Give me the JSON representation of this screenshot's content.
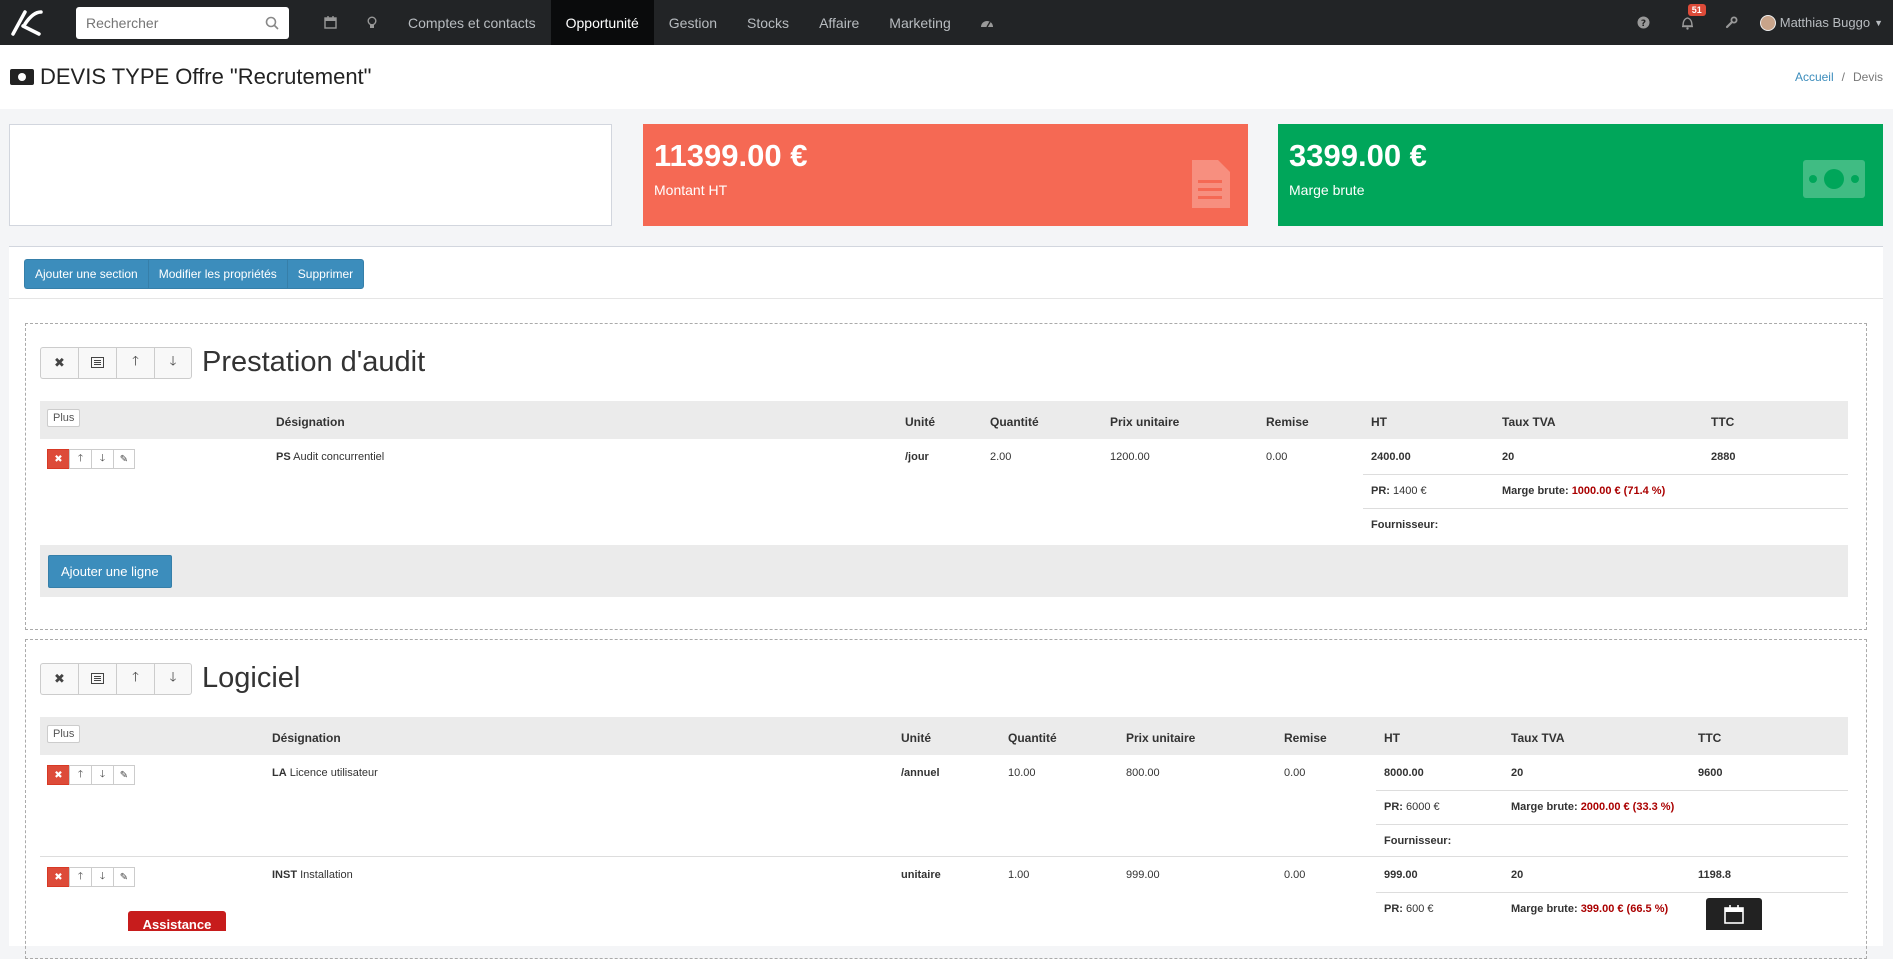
{
  "navbar": {
    "search_placeholder": "Rechercher",
    "items": [
      {
        "label": "Comptes et contacts"
      },
      {
        "label": "Opportunité"
      },
      {
        "label": "Gestion"
      },
      {
        "label": "Stocks"
      },
      {
        "label": "Affaire"
      },
      {
        "label": "Marketing"
      }
    ],
    "notification_count": "51",
    "user_name": "Matthias Buggo"
  },
  "page": {
    "title": "DEVIS TYPE Offre \"Recrutement\"",
    "breadcrumb": [
      "Accueil",
      "Devis"
    ]
  },
  "stats": {
    "amount_value": "11399.00 €",
    "amount_label": "Montant HT",
    "margin_value": "3399.00 €",
    "margin_label": "Marge brute"
  },
  "toolbar": {
    "add_section": "Ajouter une section",
    "edit_props": "Modifier les propriétés",
    "delete": "Supprimer"
  },
  "columns": {
    "plus": "Plus",
    "designation": "Désignation",
    "unit": "Unité",
    "qty": "Quantité",
    "unit_price": "Prix unitaire",
    "discount": "Remise",
    "ht": "HT",
    "vat": "Taux TVA",
    "ttc": "TTC"
  },
  "labels": {
    "pr": "PR:",
    "margin": "Marge brute:",
    "supplier": "Fournisseur:",
    "add_line": "Ajouter une ligne",
    "assistance": "Assistance"
  },
  "sections": [
    {
      "title": "Prestation d'audit",
      "lines": [
        {
          "code": "PS",
          "name": "Audit concurrentiel",
          "unit": "/jour",
          "qty": "2.00",
          "price": "1200.00",
          "discount": "0.00",
          "ht": "2400.00",
          "vat": "20",
          "ttc": "2880",
          "pr": "1400 €",
          "margin": "1000.00 € (71.4 %)"
        }
      ]
    },
    {
      "title": "Logiciel",
      "lines": [
        {
          "code": "LA",
          "name": "Licence utilisateur",
          "unit": "/annuel",
          "qty": "10.00",
          "price": "800.00",
          "discount": "0.00",
          "ht": "8000.00",
          "vat": "20",
          "ttc": "9600",
          "pr": "6000 €",
          "margin": "2000.00 € (33.3 %)"
        },
        {
          "code": "INST",
          "name": "Installation",
          "unit": "unitaire",
          "qty": "1.00",
          "price": "999.00",
          "discount": "0.00",
          "ht": "999.00",
          "vat": "20",
          "ttc": "1198.8",
          "pr": "600 €",
          "margin": "399.00 € (66.5 %)"
        }
      ]
    }
  ],
  "colors": {
    "navbar": "#222426",
    "primary": "#3c8dbc",
    "red": "#f56954",
    "green": "#00a65a",
    "danger": "#dd4b39"
  }
}
